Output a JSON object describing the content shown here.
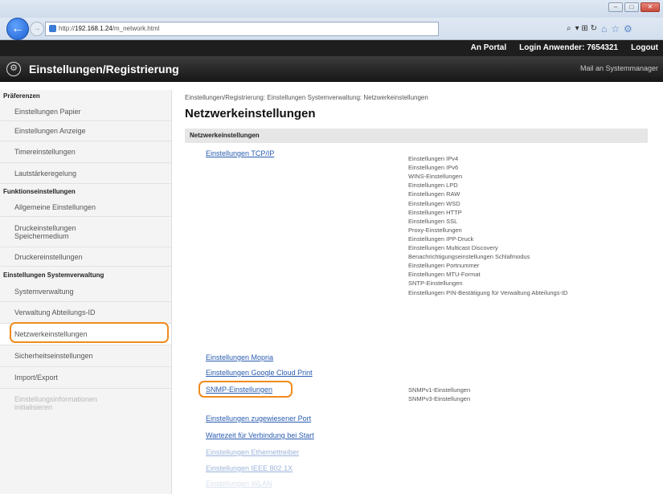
{
  "browser": {
    "url_prefix": "http://",
    "url_host": "192.168.1.24",
    "url_path": "/m_network.html",
    "search_glyph": "⌕",
    "tools_glyph": "▾ ⊞ ↻"
  },
  "portal": {
    "to_portal": "An Portal",
    "login_label": "Login Anwender:",
    "login_user": "7654321",
    "logout": "Logout"
  },
  "header": {
    "title": "Einstellungen/Registrierung",
    "mail": "Mail an Systemmanager"
  },
  "sidebar": {
    "sections": {
      "prefs": "Präferenzen",
      "functions": "Funktionseinstellungen",
      "system": "Einstellungen Systemverwaltung"
    },
    "items": {
      "paper": "Einstellungen Papier",
      "display": "Einstellungen Anzeige",
      "timer": "Timereinstellungen",
      "volume": "Lautstärkeregelung",
      "general": "Allgemeine Einstellungen",
      "print_line1": "Druckeinstellungen",
      "print_line2": "Speichermedium",
      "printer": "Druckereinstellungen",
      "sysmgmt": "Systemverwaltung",
      "dept_id": "Verwaltung Abteilungs-ID",
      "network": "Netzwerkeinstellungen",
      "security": "Sicherheitseinstellungen",
      "import_export": "Import/Export",
      "init_line1": "Einstellungsinformationen",
      "init_line2": "initialisieren"
    }
  },
  "main": {
    "breadcrumb": "Einstellungen/Registrierung: Einstellungen Systemverwaltung: Netzwerkeinstellungen",
    "title": "Netzwerkeinstellungen",
    "section_header": "Netzwerkeinstellungen",
    "links": {
      "tcpip": "Einstellungen TCP/IP",
      "mopria": "Einstellungen Mopria",
      "google_cloud_print": "Einstellungen Google Cloud Print",
      "snmp": "SNMP-Einstellungen",
      "dedicated_port": "Einstellungen zugewiesener Port",
      "wait_time": "Wartezeit für Verbindung bei Start",
      "ethernet": "Einstellungen Ethernettreiber",
      "ieee": "Einstellungen IEEE 802.1X",
      "wlan": "Einstellungen WLAN"
    },
    "tcpip_subitems": [
      "Einstellungen IPv4",
      "Einstellungen IPv6",
      "WINS-Einstellungen",
      "Einstellungen LPD",
      "Einstellungen RAW",
      "Einstellungen WSD",
      "Einstellungen HTTP",
      "Einstellungen SSL",
      "Proxy-Einstellungen",
      "Einstellungen IPP-Druck",
      "Einstellungen Multicast Discovery",
      "Benachrichtigungseinstellungen Schlafmodus",
      "Einstellungen Portnummer",
      "Einstellungen MTU-Format",
      "SNTP-Einstellungen",
      "Einstellungen PIN-Bestätigung für Verwaltung Abteilungs-ID"
    ],
    "snmp_subitems": [
      "SNMPv1-Einstellungen",
      "SNMPv3-Einstellungen"
    ]
  },
  "colors": {
    "highlight": "#f08b1d",
    "link": "#2a5db0",
    "header_bg": "#1e1e1e"
  }
}
